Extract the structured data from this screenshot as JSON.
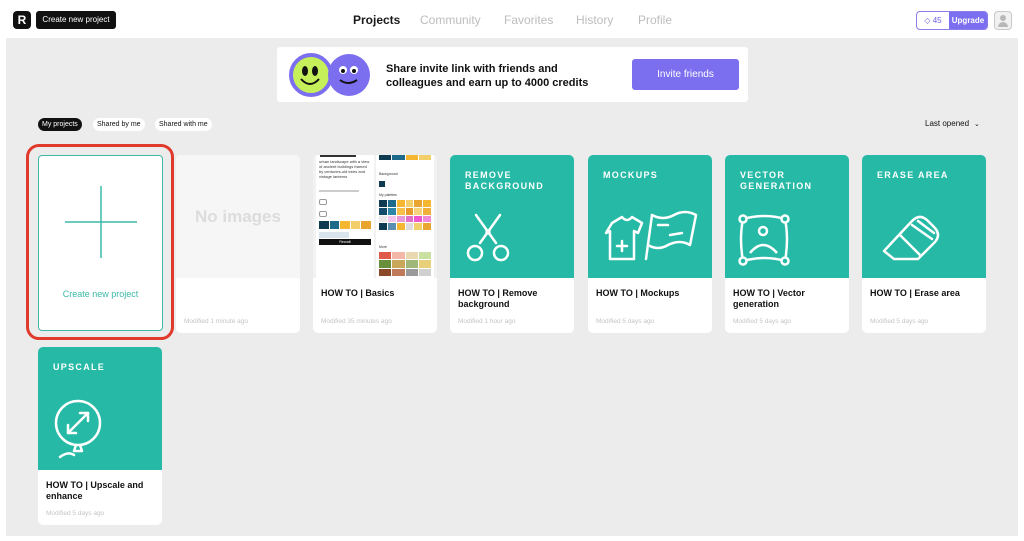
{
  "header": {
    "logo_text": "R",
    "create_button": "Create new project",
    "nav": [
      {
        "label": "Projects",
        "active": true
      },
      {
        "label": "Community",
        "active": false
      },
      {
        "label": "Favorites",
        "active": false
      },
      {
        "label": "History",
        "active": false
      },
      {
        "label": "Profile",
        "active": false
      }
    ],
    "credits": "45",
    "upgrade": "Upgrade"
  },
  "banner": {
    "line1": "Share invite link with friends and",
    "line2": "colleagues and earn up to 4000 credits",
    "button": "Invite friends"
  },
  "filters": {
    "tabs": [
      "My projects",
      "Shared by me",
      "Shared with me"
    ],
    "sort": "Last opened"
  },
  "create_card": {
    "label": "Create new project"
  },
  "projects": [
    {
      "title": "",
      "modified": "Modified 1 minute ago",
      "placeholder": "No images"
    },
    {
      "title": "HOW TO | Basics",
      "modified": "Modified 35 minutes ago"
    },
    {
      "title": "HOW TO | Remove background",
      "modified": "Modified 1 hour ago",
      "category": "REMOVE BACKGROUND",
      "icon": "scissors-icon"
    },
    {
      "title": "HOW TO | Mockups",
      "modified": "Modified 5 days ago",
      "category": "MOCKUPS",
      "icon": "tshirt-flag-icon"
    },
    {
      "title": "HOW TO | Vector generation",
      "modified": "Modified 5 days ago",
      "category": "VECTOR GENERATION",
      "icon": "vector-image-icon"
    },
    {
      "title": "HOW TO | Erase area",
      "modified": "Modified 5 days ago",
      "category": "ERASE AREA",
      "icon": "eraser-icon"
    },
    {
      "title": "HOW TO | Upscale and enhance",
      "modified": "Modified 5 days ago",
      "category": "UPSCALE",
      "icon": "upscale-balloon-icon"
    }
  ],
  "basics_preview": {
    "prompt": "urban landscape with a view of ancient buildings framed by centuries-old trees and vintage lanterns",
    "background_label": "Background",
    "palettes_label": "My palettes",
    "recraft_button": "Recraft",
    "more_label": "More"
  },
  "colors": {
    "accent_teal": "#26b9a5",
    "accent_purple": "#7b6ff0",
    "highlight_red": "#e03a2c"
  }
}
